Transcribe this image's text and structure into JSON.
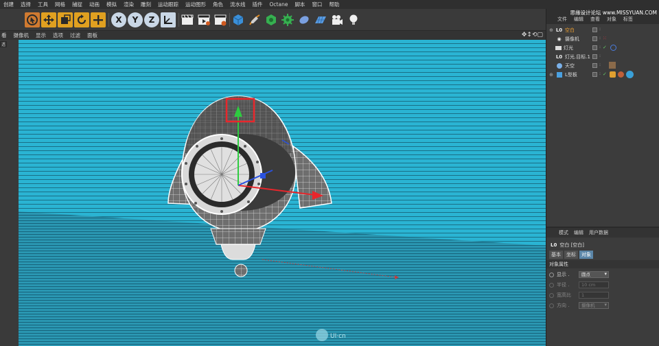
{
  "menubar": {
    "items": [
      "创建",
      "选择",
      "工具",
      "网格",
      "捕捉",
      "动画",
      "模拟",
      "渲染",
      "雕刻",
      "运动跟踪",
      "运动图形",
      "角色",
      "流水线",
      "插件",
      "Octane",
      "脚本",
      "窗口",
      "帮助"
    ]
  },
  "toolbar": {
    "axis_x": "X",
    "axis_y": "Y",
    "axis_z": "Z"
  },
  "viewport_menu": {
    "items": [
      "摄像机",
      "显示",
      "选项",
      "过滤",
      "面板"
    ],
    "tag": "透",
    "nav_icons": "✥↕⟲▢",
    "left_label": "看"
  },
  "right_panel": {
    "watermark": "思缘设计论坛 www.MISSYUAN.COM",
    "tabs": [
      "文件",
      "编辑",
      "查看",
      "对象",
      "标签"
    ],
    "objects": [
      {
        "name": "空白",
        "icon": "L0",
        "selected": true
      },
      {
        "name": "摄像机",
        "icon": "cam",
        "selected": false
      },
      {
        "name": "灯光",
        "icon": "light",
        "selected": false
      },
      {
        "name": "灯光.目标.1",
        "icon": "L0",
        "selected": false
      },
      {
        "name": "天空",
        "icon": "sky",
        "selected": false
      },
      {
        "name": "L型板",
        "icon": "obj",
        "selected": false
      }
    ],
    "attr": {
      "menu": [
        "模式",
        "编辑",
        "用户数据"
      ],
      "title_icon": "L0",
      "title": "空白 [空白]",
      "tabs": [
        "基本",
        "坐标",
        "对象"
      ],
      "section": "对象属性",
      "display_label": "显示 .",
      "display_value": "圆点",
      "radius_label": "半径 .",
      "radius_value": "10 cm",
      "aspect_label": "宽高比",
      "aspect_value": "1",
      "orientation_label": "方向 .",
      "orientation_value": "摄像机"
    }
  },
  "colors": {
    "viewport_bg": "#28b6d4",
    "highlight_box": "#e8262b",
    "selected_text": "#f0a030",
    "active_tab": "#5b86a8"
  },
  "footer_logo": "UI·cn"
}
